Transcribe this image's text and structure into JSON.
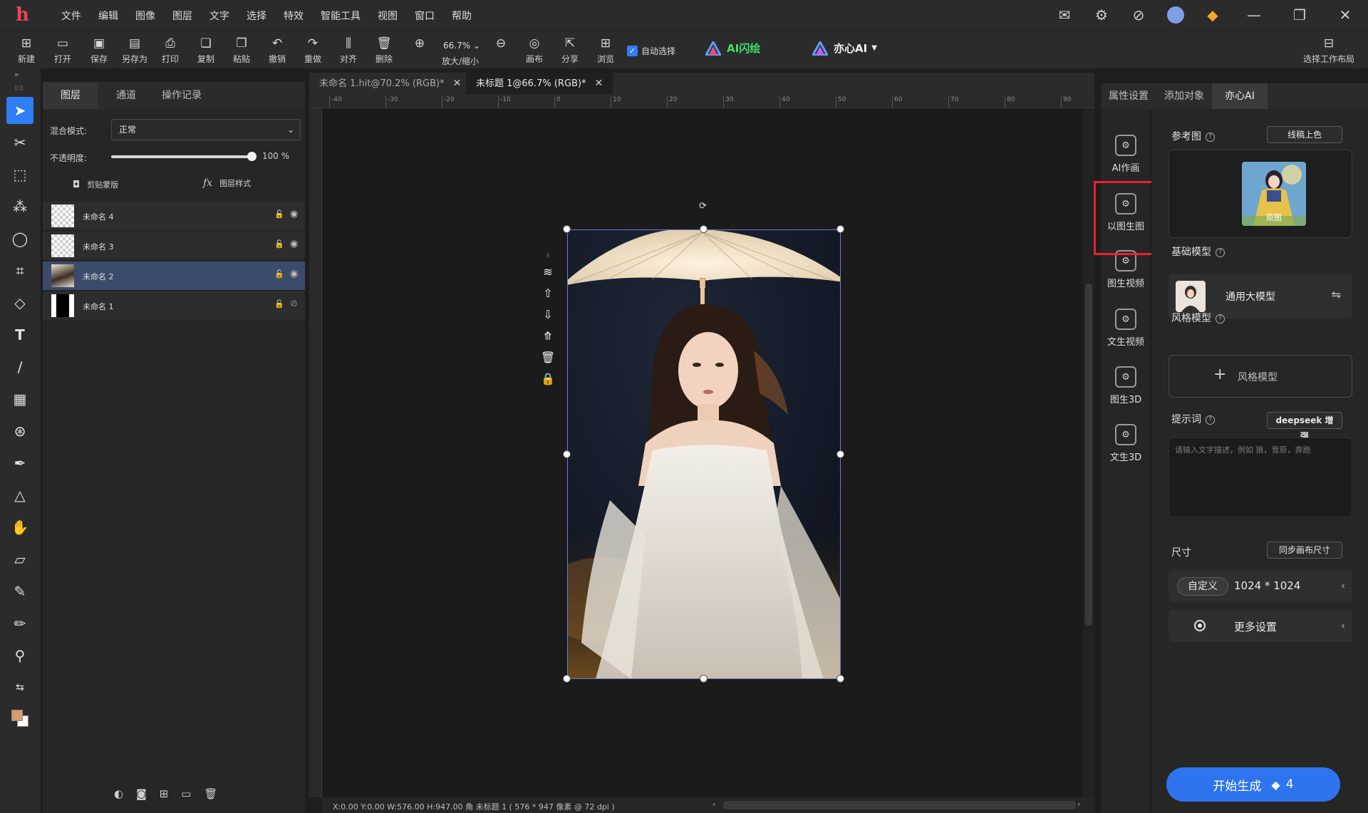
{
  "menubar": {
    "logo": "h",
    "items": [
      "文件",
      "编辑",
      "图像",
      "图层",
      "文字",
      "选择",
      "特效",
      "智能工具",
      "视图",
      "窗口",
      "帮助"
    ],
    "right_icons": [
      "mail-icon",
      "settings-icon",
      "compass-icon",
      "avatar",
      "vip-gem-icon",
      "minimize-icon",
      "restore-icon",
      "close-icon"
    ]
  },
  "toolbar": {
    "new": "新建",
    "open": "打开",
    "save": "保存",
    "save_as": "另存为",
    "print": "打印",
    "copy": "复制",
    "paste": "粘贴",
    "undo": "撤销",
    "redo": "重做",
    "align": "对齐",
    "delete": "删除",
    "zoom_value": "66.7%",
    "zoom_label": "放大/缩小",
    "canvas": "画布",
    "share": "分享",
    "browse": "浏览",
    "auto_select": "自动选择",
    "ai_flash": "AI闪绘",
    "yixin_ai": "亦心AI",
    "layout": "选择工作布局"
  },
  "layers_panel": {
    "tabs": [
      "图层",
      "通道",
      "操作记录"
    ],
    "blend_label": "混合模式:",
    "blend_value": "正常",
    "opacity_label": "不透明度:",
    "opacity_value": "100",
    "opacity_unit": "%",
    "opacity_fraction": 1.0,
    "clip_mask": "剪贴蒙版",
    "layer_style": "图层样式",
    "layers": [
      {
        "name": "未命名 4",
        "selected": false
      },
      {
        "name": "未命名 3",
        "selected": false
      },
      {
        "name": "未命名 2",
        "selected": true
      },
      {
        "name": "未命名 1",
        "selected": false
      }
    ]
  },
  "documents": {
    "tabs": [
      {
        "title": "未命名 1.hit@70.2% (RGB)*",
        "active": false
      },
      {
        "title": "未标题 1@66.7% (RGB)*",
        "active": true
      }
    ],
    "ruler_ticks": [
      "-40",
      "-30",
      "-20",
      "-10",
      "0",
      "10",
      "20",
      "30",
      "40",
      "50",
      "60",
      "70",
      "80",
      "90"
    ],
    "status": "X:0.00 Y:0.00 W:576.00 H:947.00 角    未标题 1 ( 576 * 947 像素 @ 72 dpi )"
  },
  "right_panel": {
    "tabs": [
      "属性设置",
      "添加对象",
      "亦心AI"
    ],
    "ai_items": [
      "AI作画",
      "以图生图",
      "图生视频",
      "文生视频",
      "图生3D",
      "文生3D"
    ],
    "highlighted_item": "以图生图",
    "reference_label": "参考图",
    "line_color_btn": "线稿上色",
    "ref_caption": "原图",
    "base_model_label": "基础模型",
    "base_model_name": "通用大模型",
    "style_model_label": "风格模型",
    "style_model_add": "风格模型",
    "prompt_label": "提示词",
    "deepseek_btn": "deepseek 增强",
    "prompt_placeholder": "请输入文字描述，例如 狼，雪原，奔跑",
    "size_label": "尺寸",
    "sync_size_btn": "同步画布尺寸",
    "size_mode": "自定义",
    "size_value": "1024 * 1024",
    "more_settings": "更多设置",
    "generate_label": "开始生成",
    "generate_cost": "4"
  },
  "colors": {
    "accent": "#2e74ee",
    "highlight_border": "#e8222f",
    "ai_flash": "#3fe06a"
  }
}
